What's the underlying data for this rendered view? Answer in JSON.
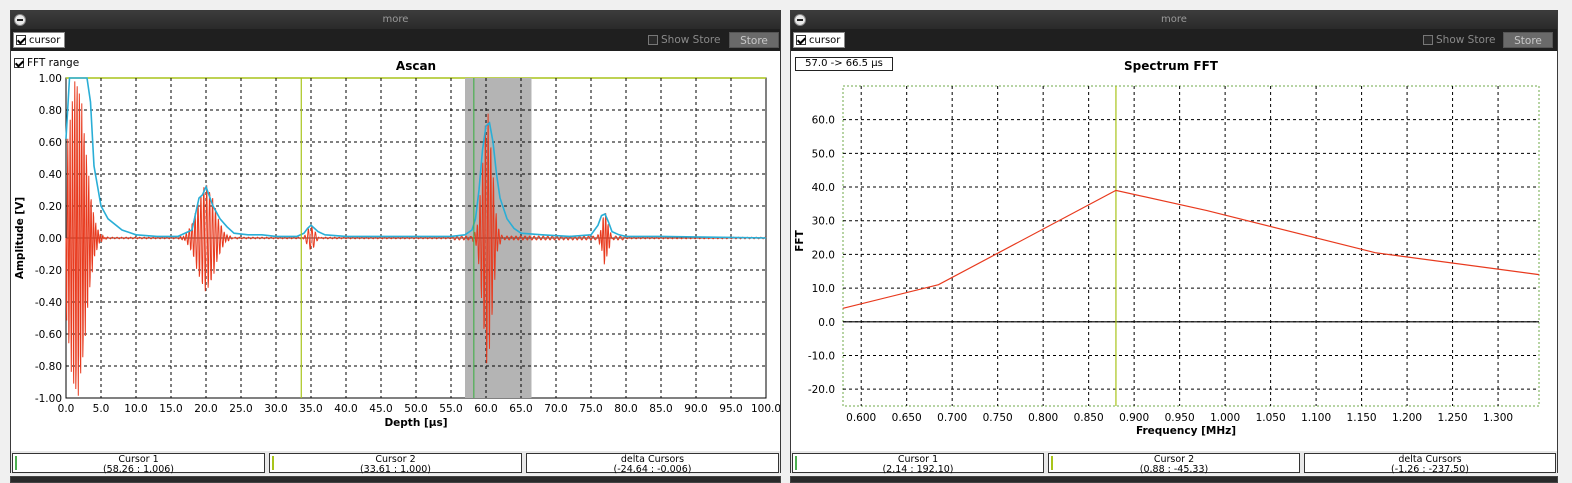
{
  "colors": {
    "signal": "#e83a1e",
    "envelope": "#2aaed6",
    "cursor_a": "#a8c41a",
    "cursor_b": "#4caf50",
    "gate_fill": "#b4b4b4",
    "grid": "#000000"
  },
  "panels": [
    {
      "header": {
        "title": "more",
        "collapse_icon": "minus-circle-icon"
      },
      "toolbar": {
        "cursor_label": "cursor",
        "cursor_checked": true,
        "show_store_label": "Show Store",
        "show_store_checked": false,
        "store_label": "Store"
      },
      "plot": {
        "fft_range_label": "FFT range",
        "fft_range_checked": true
      }
    },
    {
      "header": {
        "title": "more",
        "collapse_icon": "minus-circle-icon"
      },
      "toolbar": {
        "cursor_label": "cursor",
        "cursor_checked": true,
        "show_store_label": "Show Store",
        "show_store_checked": false,
        "store_label": "Store"
      },
      "plot": {
        "range_readout": "57.0 -> 66.5 µs"
      }
    }
  ],
  "chart_data": [
    {
      "type": "line",
      "title": "Ascan",
      "xlabel": "Depth [µs]",
      "ylabel": "Amplitude [V]",
      "xlim": [
        0,
        100
      ],
      "ylim": [
        -1.0,
        1.0
      ],
      "xticks": [
        "0.0",
        "5.0",
        "10.0",
        "15.0",
        "20.0",
        "25.0",
        "30.0",
        "35.0",
        "40.0",
        "45.0",
        "50.0",
        "55.0",
        "60.0",
        "65.0",
        "70.0",
        "75.0",
        "80.0",
        "85.0",
        "90.0",
        "95.0",
        "100.0"
      ],
      "yticks": [
        "1.00",
        "0.80",
        "0.60",
        "0.40",
        "0.20",
        "0.00",
        "-0.20",
        "-0.40",
        "-0.60",
        "-0.80",
        "-1.00"
      ],
      "grid": true,
      "gate": {
        "x_start": 57.0,
        "x_end": 66.5
      },
      "cursors": [
        {
          "name": "Cursor 1",
          "x": 58.26
        },
        {
          "name": "Cursor 2",
          "x": 33.61
        }
      ],
      "echoes": [
        {
          "center": 1.5,
          "amp": 1.0,
          "width": 1.8,
          "freq": 1.5
        },
        {
          "center": 20.0,
          "amp": 0.33,
          "width": 1.8,
          "freq": 1.2
        },
        {
          "center": 35.0,
          "amp": 0.07,
          "width": 0.8,
          "freq": 1.0
        },
        {
          "center": 60.2,
          "amp": 0.78,
          "width": 1.0,
          "freq": 1.3
        },
        {
          "center": 77.0,
          "amp": 0.16,
          "width": 0.6,
          "freq": 1.4
        }
      ],
      "envelope": {
        "x": [
          0,
          0.5,
          1.0,
          1.5,
          2.0,
          2.5,
          3.0,
          3.5,
          4.0,
          5.0,
          6.0,
          8.0,
          10.0,
          13.0,
          16.0,
          18.0,
          18.5,
          19.0,
          19.5,
          20.0,
          20.5,
          21.0,
          22.0,
          23.0,
          24.0,
          26.0,
          28.0,
          30.0,
          33.0,
          34.0,
          34.5,
          35.0,
          35.5,
          36.0,
          37.0,
          40.0,
          45.0,
          50.0,
          55.0,
          57.0,
          58.0,
          58.5,
          59.0,
          59.5,
          60.0,
          60.5,
          61.0,
          61.5,
          62.0,
          63.0,
          64.0,
          65.0,
          68.0,
          72.0,
          75.0,
          76.0,
          76.5,
          77.0,
          77.5,
          78.0,
          79.0,
          80.0,
          85.0,
          100.0
        ],
        "y": [
          0.62,
          1.0,
          1.0,
          1.0,
          1.0,
          1.0,
          1.0,
          0.85,
          0.45,
          0.2,
          0.12,
          0.05,
          0.02,
          0.01,
          0.01,
          0.05,
          0.15,
          0.25,
          0.27,
          0.32,
          0.26,
          0.2,
          0.12,
          0.07,
          0.03,
          0.02,
          0.02,
          0.01,
          0.01,
          0.03,
          0.06,
          0.08,
          0.06,
          0.04,
          0.02,
          0.01,
          0.01,
          0.01,
          0.01,
          0.02,
          0.05,
          0.12,
          0.3,
          0.55,
          0.7,
          0.72,
          0.6,
          0.4,
          0.25,
          0.12,
          0.06,
          0.03,
          0.02,
          0.01,
          0.02,
          0.08,
          0.14,
          0.15,
          0.1,
          0.04,
          0.02,
          0.01,
          0.01,
          0.0
        ]
      },
      "status": [
        {
          "label": "Cursor 1",
          "value": "(58.26 : 1.006)",
          "marker_color": "#4caf50"
        },
        {
          "label": "Cursor 2",
          "value": "(33.61 : 1.000)",
          "marker_color": "#a8c41a"
        },
        {
          "label": "delta Cursors",
          "value": "(-24.64 : -0.006)",
          "marker_color": ""
        }
      ]
    },
    {
      "type": "line",
      "title": "Spectrum FFT",
      "xlabel": "Frequency [MHz]",
      "ylabel": "FFT",
      "xlim": [
        0.58,
        1.345
      ],
      "ylim": [
        -25,
        70
      ],
      "xticks": [
        "0.600",
        "0.650",
        "0.700",
        "0.750",
        "0.800",
        "0.850",
        "0.900",
        "0.950",
        "1.000",
        "1.050",
        "1.100",
        "1.150",
        "1.200",
        "1.250",
        "1.300"
      ],
      "xtick_values": [
        0.6,
        0.65,
        0.7,
        0.75,
        0.8,
        0.85,
        0.9,
        0.95,
        1.0,
        1.05,
        1.1,
        1.15,
        1.2,
        1.25,
        1.3
      ],
      "yticks": [
        "60.0",
        "50.0",
        "40.0",
        "30.0",
        "20.0",
        "10.0",
        "0.0",
        "-10.0",
        "-20.0"
      ],
      "ytick_values": [
        60,
        50,
        40,
        30,
        20,
        10,
        0,
        -10,
        -20
      ],
      "grid": true,
      "cursor_x": 0.88,
      "series": [
        {
          "x": [
            0.58,
            0.685,
            0.88,
            0.98,
            1.165,
            1.345
          ],
          "y": [
            4.0,
            11.0,
            39.0,
            33.0,
            20.5,
            14.0
          ]
        }
      ],
      "status": [
        {
          "label": "Cursor 1",
          "value": "(2.14 : 192.10)",
          "marker_color": "#4caf50"
        },
        {
          "label": "Cursor 2",
          "value": "(0.88 : -45.33)",
          "marker_color": "#a8c41a"
        },
        {
          "label": "delta Cursors",
          "value": "(-1.26 : -237.50)",
          "marker_color": ""
        }
      ]
    }
  ]
}
